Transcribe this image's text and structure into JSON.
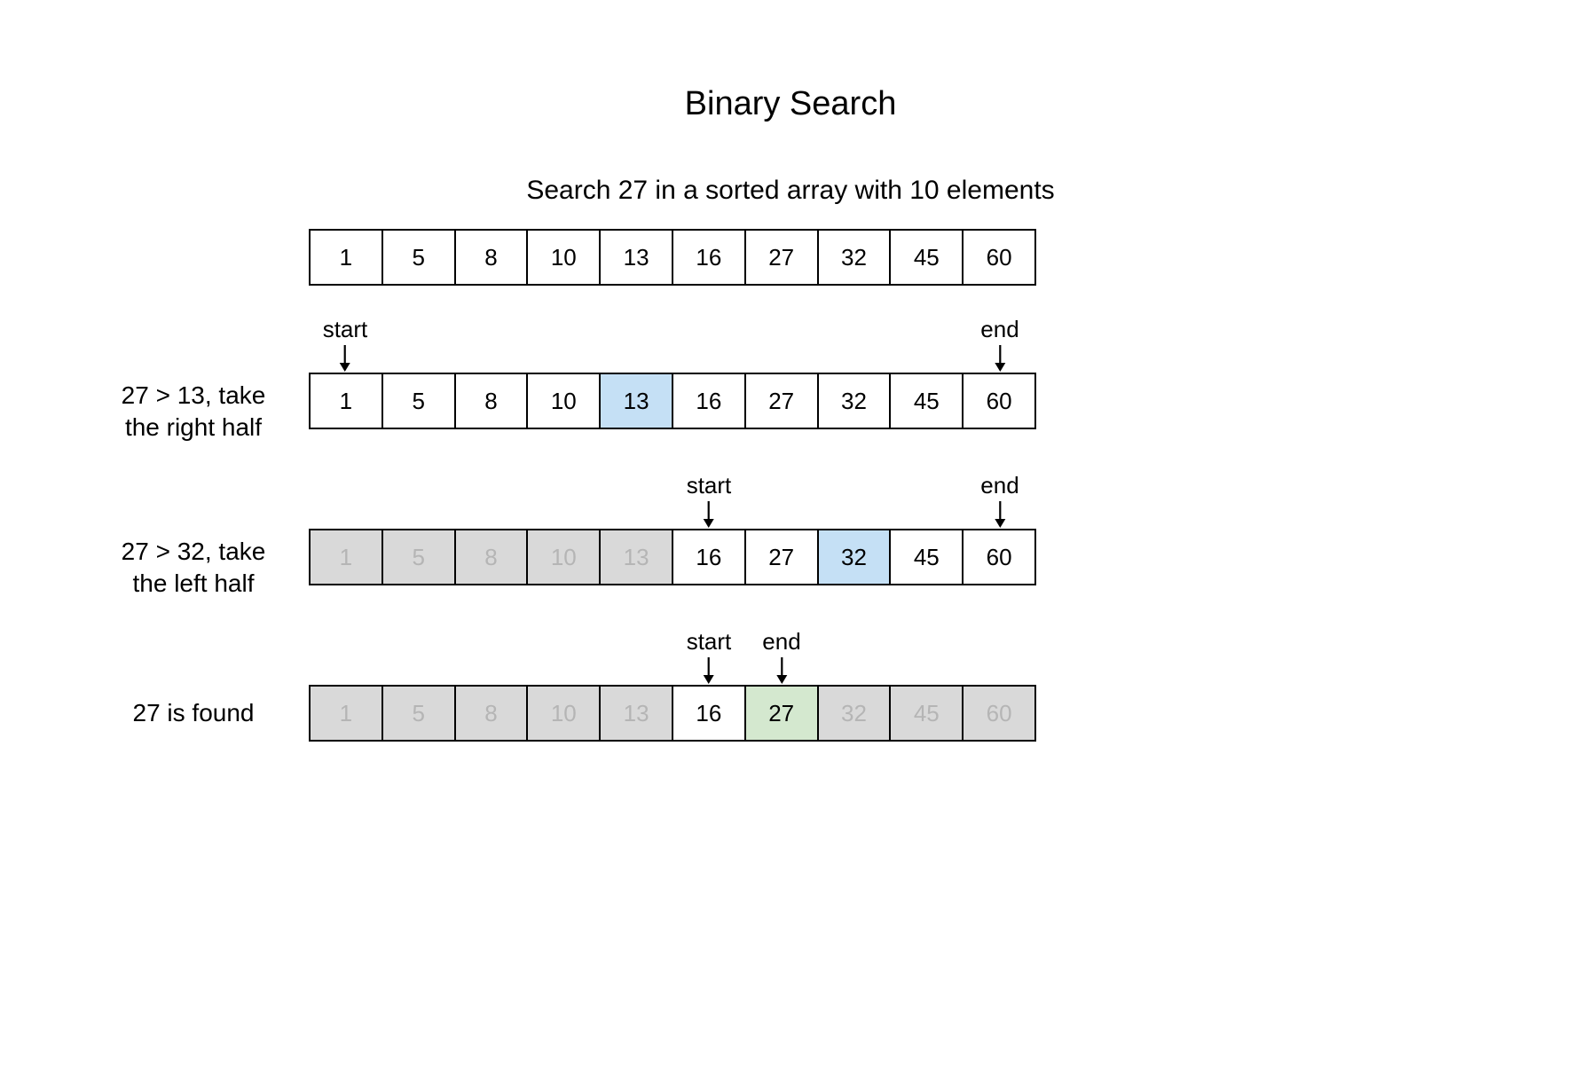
{
  "title": "Binary Search",
  "subtitle": "Search 27 in a sorted array with 10 elements",
  "array": [
    1,
    5,
    8,
    10,
    13,
    16,
    27,
    32,
    45,
    60
  ],
  "pointers": {
    "start": "start",
    "end": "end"
  },
  "steps": [
    {
      "caption_line1": "27 > 13, take",
      "caption_line2": "the right half",
      "start_idx": 0,
      "end_idx": 9,
      "mid_idx": 4,
      "inactive": [],
      "found_idx": null
    },
    {
      "caption_line1": "27 > 32, take",
      "caption_line2": "the left half",
      "start_idx": 5,
      "end_idx": 9,
      "mid_idx": 7,
      "inactive": [
        0,
        1,
        2,
        3,
        4
      ],
      "found_idx": null
    },
    {
      "caption_line1": "27 is found",
      "caption_line2": "",
      "start_idx": 5,
      "end_idx": 6,
      "mid_idx": null,
      "inactive": [
        0,
        1,
        2,
        3,
        4,
        7,
        8,
        9
      ],
      "found_idx": 6
    }
  ]
}
